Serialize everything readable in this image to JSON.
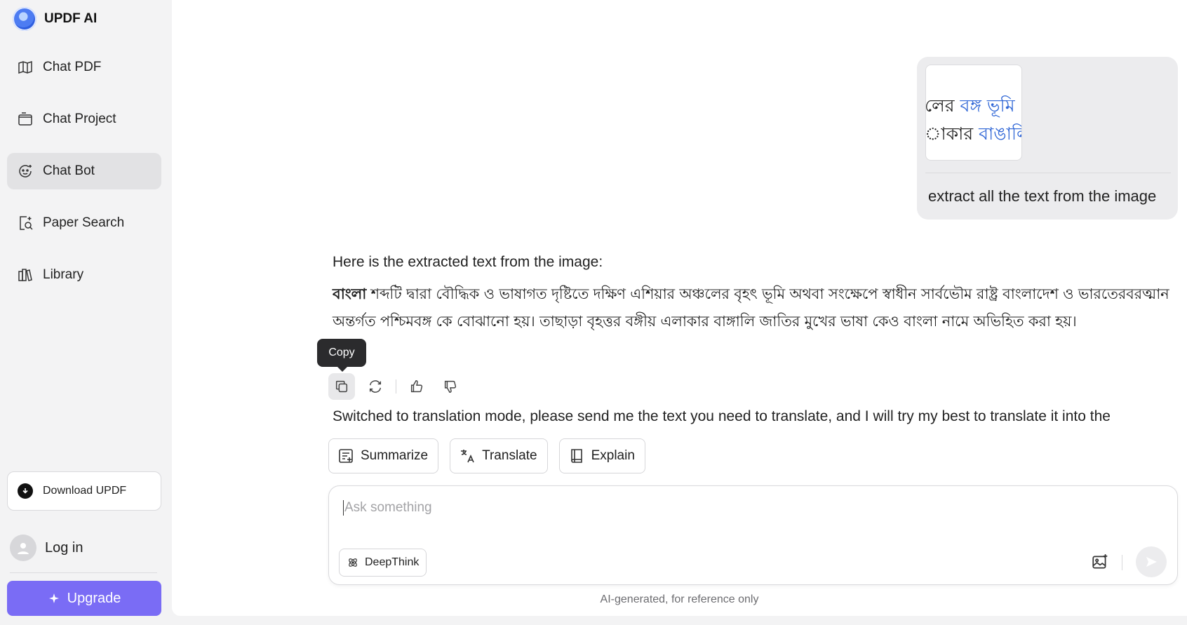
{
  "app": {
    "name": "UPDF AI"
  },
  "sidebar": {
    "items": [
      {
        "label": "Chat PDF",
        "icon": "map-book-icon"
      },
      {
        "label": "Chat Project",
        "icon": "folder-icon"
      },
      {
        "label": "Chat Bot",
        "icon": "bot-face-icon",
        "active": true
      },
      {
        "label": "Paper Search",
        "icon": "doc-search-icon"
      },
      {
        "label": "Library",
        "icon": "books-icon"
      }
    ],
    "download_label": "Download UPDF",
    "login_label": "Log in",
    "upgrade_label": "Upgrade"
  },
  "chat": {
    "user_image_lines": [
      {
        "plain": "লের ",
        "link": "বঙ্গ ভূমি"
      },
      {
        "plain": "াকার ",
        "link": "বাঙালি "
      }
    ],
    "user_message": "extract all the text from the image",
    "assistant_intro": "Here is the extracted text from the image:",
    "assistant_bold": "বাংলা",
    "assistant_body": " শব্দটি দ্বারা বৌদ্ধিক ও ভাষাগত দৃষ্টিতে দক্ষিণ এশিয়ার অঞ্চলের বৃহৎ ভূমি অথবা সংক্ষেপে স্বাধীন সার্বভৌম রাষ্ট্র বাংলাদেশ ও ভারতেরবরত্মান অন্তর্গত পশ্চিমবঙ্গ কে বোঝানো হয়। তাছাড়া বৃহত্তর বঙ্গীয় এলাকার বাঙ্গালি জাতির মুখের ভাষা কেও বাংলা নামে অভিহিত করা হয়।",
    "tooltip": "Copy",
    "translation_note": "Switched to translation mode, please send me the text you need to translate, and I will try my best to translate it into the"
  },
  "chips": [
    {
      "label": "Summarize"
    },
    {
      "label": "Translate"
    },
    {
      "label": "Explain"
    }
  ],
  "input": {
    "placeholder": "Ask something",
    "deepthink_label": "DeepThink"
  },
  "disclaimer": "AI-generated, for reference only",
  "colors": {
    "accent": "#7a6cf5",
    "link": "#2f66d6"
  }
}
